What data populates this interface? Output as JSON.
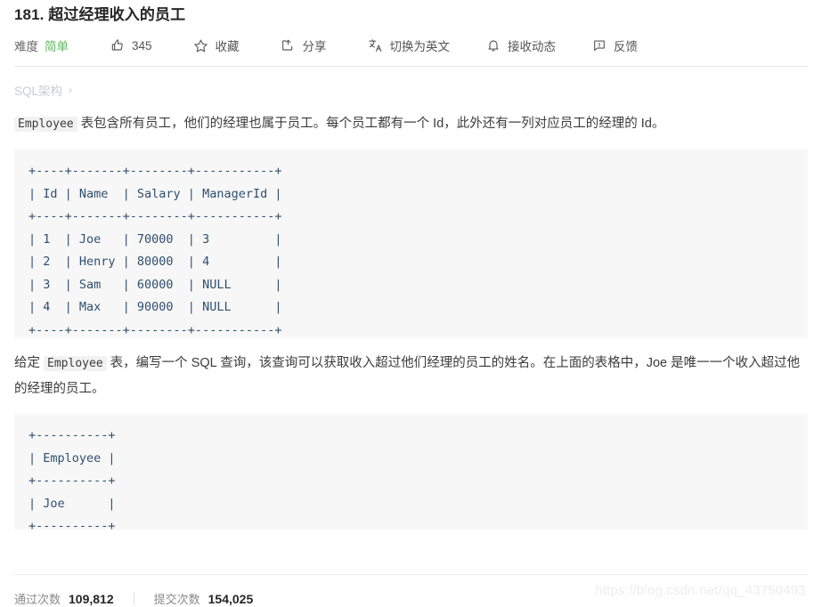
{
  "problem": {
    "number": "181.",
    "title": "超过经理收入的员工",
    "full_title": "181. 超过经理收入的员工"
  },
  "toolbar": {
    "difficulty_label": "难度",
    "difficulty_value": "简单",
    "like_count": "345",
    "favorite_label": "收藏",
    "share_label": "分享",
    "translate_label": "切换为英文",
    "subscribe_label": "接收动态",
    "feedback_label": "反馈"
  },
  "breadcrumb": {
    "label": "SQL架构",
    "chevron": "›"
  },
  "description": {
    "code_term": "Employee",
    "text_after": " 表包含所有员工，他们的经理也属于员工。每个员工都有一个 Id，此外还有一列对应员工的经理的 Id。"
  },
  "table_block": {
    "content": "+----+-------+--------+-----------+\n| Id | Name  | Salary | ManagerId |\n+----+-------+--------+-----------+\n| 1  | Joe   | 70000  | 3         |\n| 2  | Henry | 80000  | 4         |\n| 3  | Sam   | 60000  | NULL      |\n| 4  | Max   | 90000  | NULL      |\n+----+-------+--------+-----------+"
  },
  "task": {
    "text_before": "给定 ",
    "code_term": "Employee",
    "text_after": " 表，编写一个 SQL 查询，该查询可以获取收入超过他们经理的员工的姓名。在上面的表格中，Joe 是唯一一个收入超过他的经理的员工。"
  },
  "output_block": {
    "content": "+----------+\n| Employee |\n+----------+\n| Joe      |\n+----------+"
  },
  "stats": {
    "accepted_label": "通过次数",
    "accepted_value": "109,812",
    "submissions_label": "提交次数",
    "submissions_value": "154,025"
  },
  "watermark": {
    "text": "https://blog.csdn.net/qq_43750493"
  },
  "colors": {
    "difficulty_easy": "#5eb95e",
    "code_text": "#2f4f6f",
    "code_bg": "#f7f7f7",
    "breadcrumb": "#c8ccd4"
  }
}
